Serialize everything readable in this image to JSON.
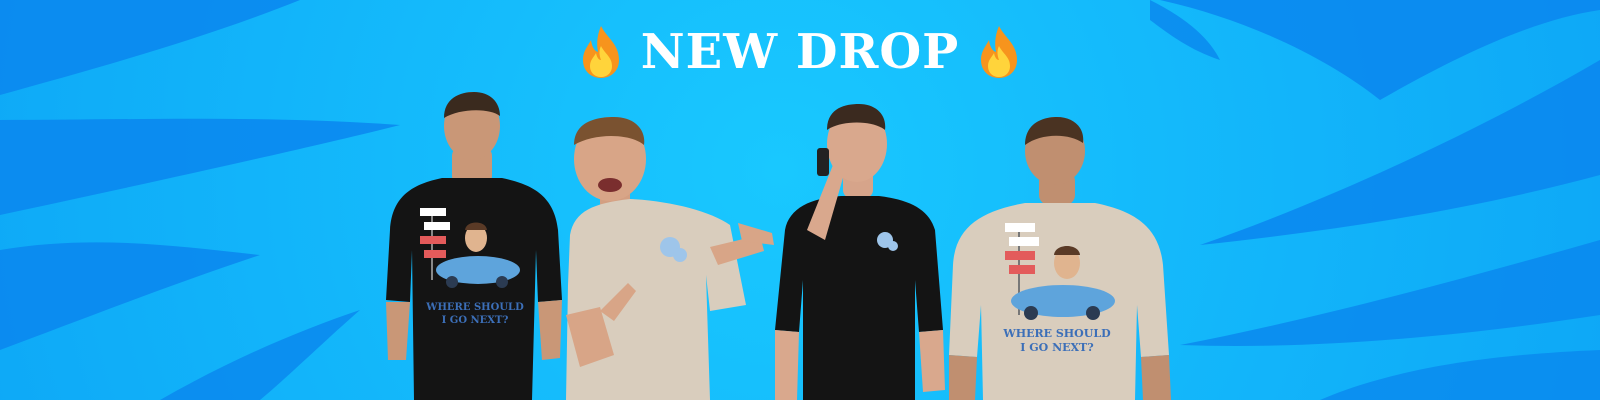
{
  "banner": {
    "headline": "NEW DROP",
    "left_icon": "fire-emoji",
    "right_icon": "fire-emoji",
    "shirt_print_text_line1": "WHERE SHOULD",
    "shirt_print_text_line2": "I GO NEXT?"
  },
  "colors": {
    "background": "#12b7fb",
    "swirl_dark": "#0a86ee",
    "headline_text": "#ffffff",
    "shirt_black": "#141414",
    "shirt_beige": "#d9cdbd",
    "print_text": "#3c6fb8"
  }
}
